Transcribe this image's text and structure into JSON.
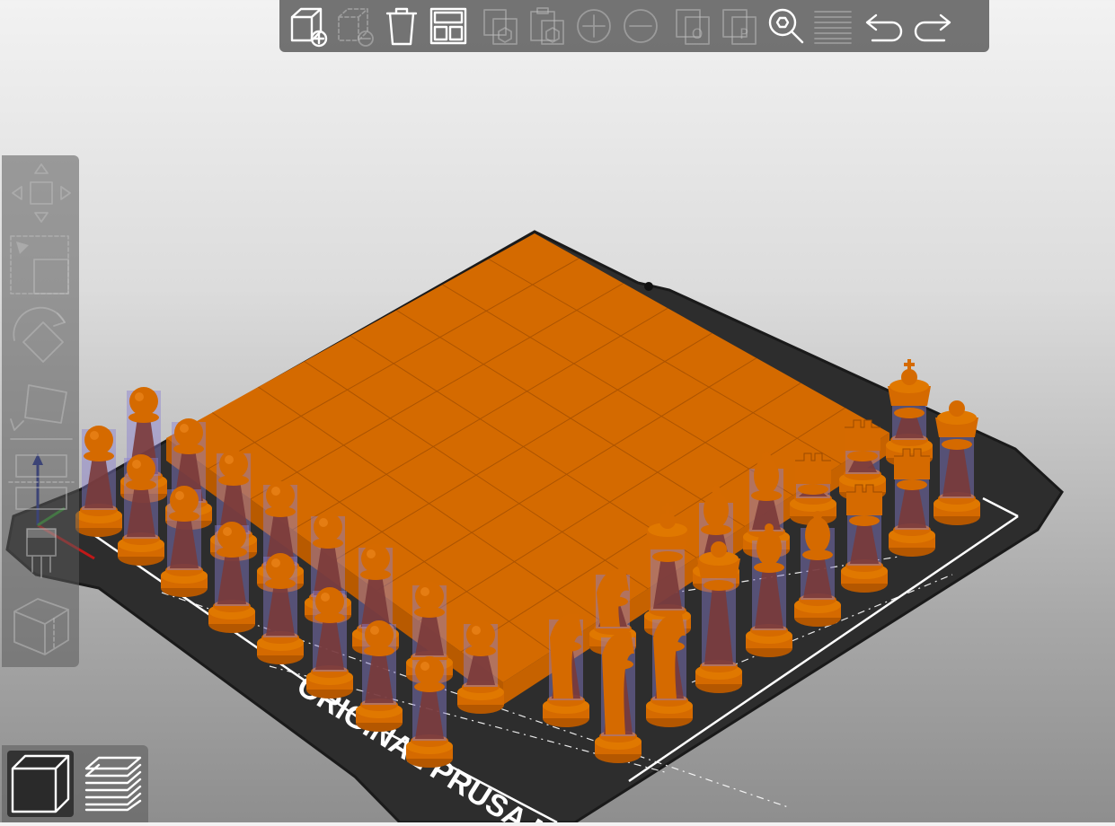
{
  "app": {
    "view": "3D plater",
    "bed_label": "ORIGINAL PRUSA MK"
  },
  "scene": {
    "colors": {
      "background_top": "#f2f2f2",
      "background_bottom": "#8e8e8e",
      "bed": "#2e2e2e",
      "bed_edge": "#1a1a1a",
      "bed_lines": "#ffffff",
      "model": "#d56a00",
      "model_shadow": "#b45700",
      "support_enforcer": "#8a7fd0"
    },
    "objects": [
      {
        "name": "Chess board"
      },
      {
        "name": "Pawn"
      },
      {
        "name": "Pawn"
      },
      {
        "name": "Pawn"
      },
      {
        "name": "Pawn"
      },
      {
        "name": "Pawn"
      },
      {
        "name": "Pawn"
      },
      {
        "name": "Pawn"
      },
      {
        "name": "Pawn"
      },
      {
        "name": "Rook"
      },
      {
        "name": "Rook"
      },
      {
        "name": "Knight"
      },
      {
        "name": "Knight"
      },
      {
        "name": "Bishop"
      },
      {
        "name": "Bishop"
      },
      {
        "name": "Queen"
      },
      {
        "name": "King"
      }
    ]
  },
  "top_toolbar": [
    {
      "id": "add",
      "icon": "add-object-icon",
      "enabled": true,
      "title": "Add"
    },
    {
      "id": "delete",
      "icon": "delete-object-icon",
      "enabled": false,
      "title": "Delete"
    },
    {
      "id": "delete_all",
      "icon": "trash-icon",
      "enabled": true,
      "title": "Delete all"
    },
    {
      "id": "arrange",
      "icon": "arrange-icon",
      "enabled": true,
      "title": "Arrange"
    },
    {
      "id": "copy",
      "icon": "copy-icon",
      "enabled": false,
      "title": "Copy"
    },
    {
      "id": "paste",
      "icon": "paste-icon",
      "enabled": false,
      "title": "Paste"
    },
    {
      "id": "add_instance",
      "icon": "add-instance-icon",
      "enabled": false,
      "title": "Add instance"
    },
    {
      "id": "remove_instance",
      "icon": "remove-instance-icon",
      "enabled": false,
      "title": "Remove instance"
    },
    {
      "id": "split_objects",
      "icon": "split-objects-icon",
      "enabled": false,
      "title": "Split to objects"
    },
    {
      "id": "split_parts",
      "icon": "split-parts-icon",
      "enabled": false,
      "title": "Split to parts"
    },
    {
      "id": "search",
      "icon": "search-icon",
      "enabled": true,
      "title": "Search"
    },
    {
      "id": "layers",
      "icon": "layers-editing-icon",
      "enabled": false,
      "title": "Variable layer height"
    },
    {
      "id": "undo",
      "icon": "undo-icon",
      "enabled": true,
      "title": "Undo"
    },
    {
      "id": "redo",
      "icon": "redo-icon",
      "enabled": true,
      "title": "Redo"
    }
  ],
  "left_toolbar": [
    {
      "id": "move",
      "icon": "move-icon"
    },
    {
      "id": "scale",
      "icon": "scale-icon"
    },
    {
      "id": "rotate",
      "icon": "rotate-icon"
    },
    {
      "id": "place_on_face",
      "icon": "place-on-face-icon"
    },
    {
      "id": "cut",
      "icon": "cut-icon"
    },
    {
      "id": "paint_supports",
      "icon": "paint-supports-icon"
    },
    {
      "id": "seam",
      "icon": "seam-painting-icon"
    }
  ],
  "view_toggle": [
    {
      "id": "view_3d",
      "icon": "3d-view-icon",
      "active": true
    },
    {
      "id": "preview",
      "icon": "layers-preview-icon",
      "active": false
    }
  ]
}
